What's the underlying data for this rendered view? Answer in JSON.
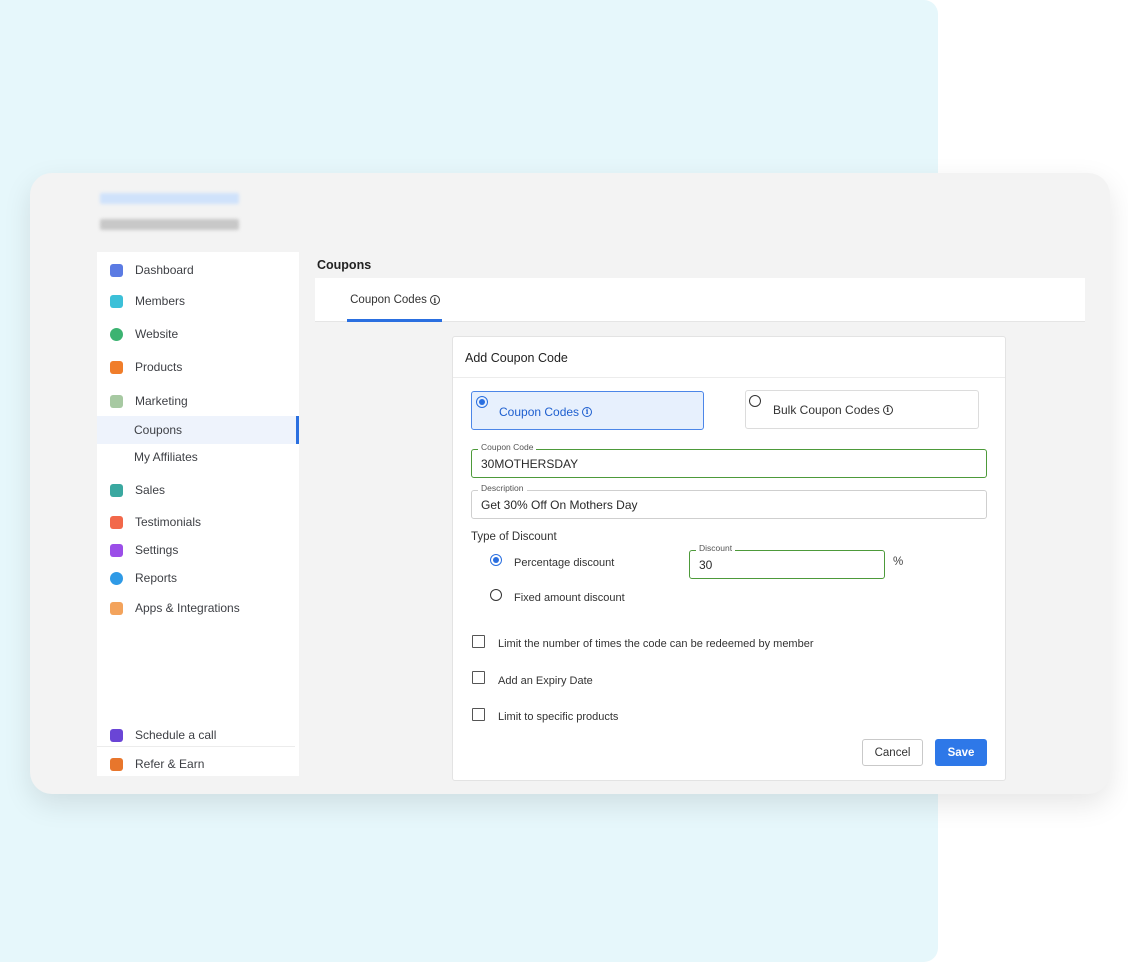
{
  "sidebar": {
    "items": [
      {
        "label": "Dashboard",
        "icon": "dashboard-icon",
        "color": "#5b7be3"
      },
      {
        "label": "Members",
        "icon": "members-icon",
        "color": "#3cc0d8"
      },
      {
        "label": "Website",
        "icon": "globe-icon",
        "color": "#3cb371"
      },
      {
        "label": "Products",
        "icon": "book-icon",
        "color": "#f07d2a"
      },
      {
        "label": "Marketing",
        "icon": "marketing-icon",
        "color": "#a7c9a2"
      },
      {
        "label": "Coupons",
        "sub": true,
        "active": true
      },
      {
        "label": "My Affiliates",
        "sub": true
      },
      {
        "label": "Sales",
        "icon": "chart-icon",
        "color": "#3aa8a0"
      },
      {
        "label": "Testimonials",
        "icon": "star-icon",
        "color": "#f2684a"
      },
      {
        "label": "Settings",
        "icon": "gear-icon",
        "color": "#9b4ee8"
      },
      {
        "label": "Reports",
        "icon": "reports-icon",
        "color": "#2f9ae6"
      },
      {
        "label": "Apps & Integrations",
        "icon": "apps-icon",
        "color": "#f3a35c"
      }
    ],
    "footer": [
      {
        "label": "Schedule a call",
        "icon": "calendar-icon",
        "color": "#6a45d6"
      },
      {
        "label": "Refer & Earn",
        "icon": "gift-icon",
        "color": "#e8762c"
      }
    ]
  },
  "page": {
    "title": "Coupons",
    "tab_label": "Coupon Codes"
  },
  "dialog": {
    "title": "Add Coupon Code",
    "option_single": "Coupon Codes",
    "option_bulk": "Bulk Coupon Codes",
    "coupon_code_label": "Coupon Code",
    "coupon_code_value": "30MOTHERSDAY",
    "description_label": "Description",
    "description_value": "Get 30% Off On Mothers Day",
    "type_label": "Type of Discount",
    "percentage_label": "Percentage discount",
    "fixed_label": "Fixed amount discount",
    "discount_label": "Discount",
    "discount_value": "30",
    "percent_sign": "%",
    "check_limit_redeem": "Limit the number of times the code can be redeemed by member",
    "check_expiry": "Add an Expiry Date",
    "check_products": "Limit to specific products",
    "cancel_label": "Cancel",
    "save_label": "Save"
  },
  "colors": {
    "accent": "#2a6fe0",
    "valid_border": "#4d9a3a",
    "background_panel": "#e6f7fb"
  }
}
